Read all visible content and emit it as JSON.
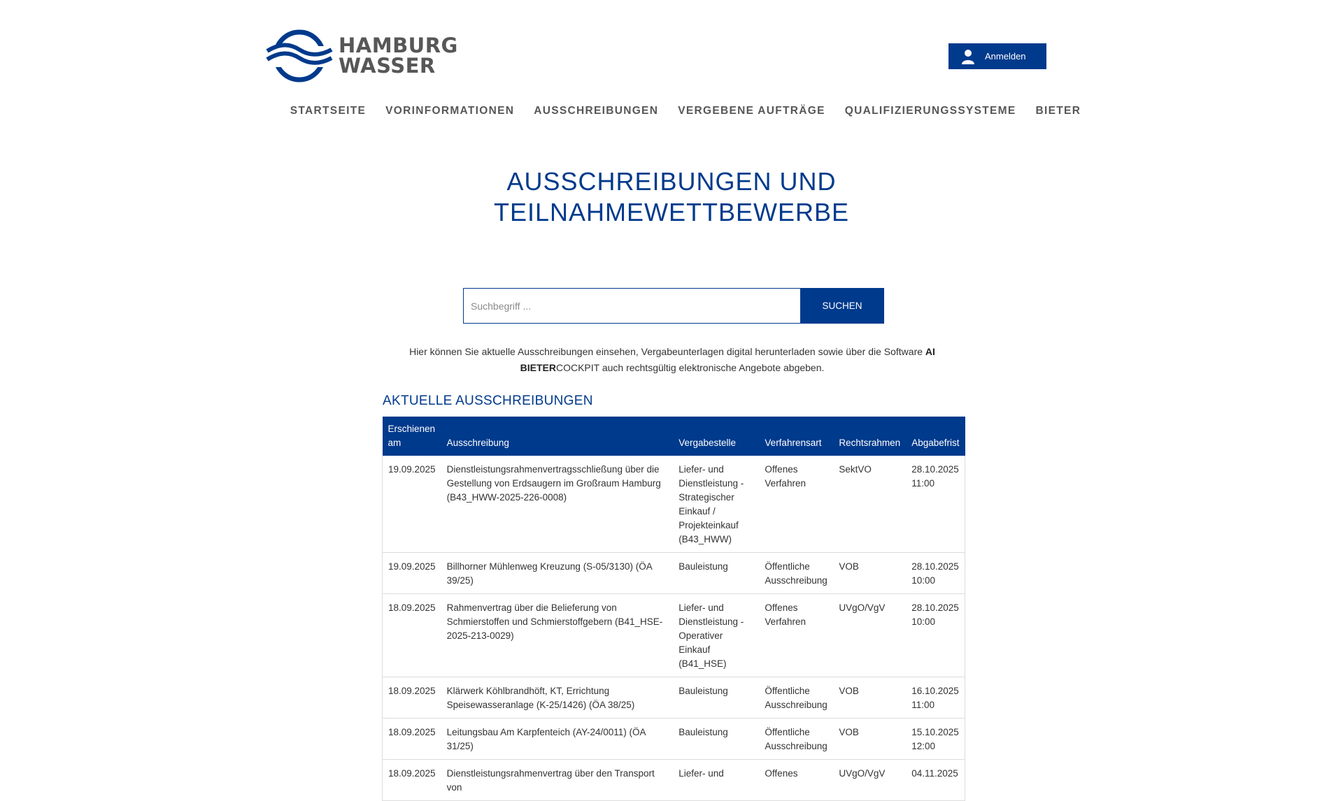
{
  "brand": {
    "line1": "HAMBURG",
    "line2": "WASSER",
    "color": "#003a8c"
  },
  "header": {
    "login_label": "Anmelden"
  },
  "nav": [
    {
      "label": "STARTSEITE"
    },
    {
      "label": "VORINFORMATIONEN"
    },
    {
      "label": "AUSSCHREIBUNGEN"
    },
    {
      "label": "VERGEBENE AUFTRÄGE"
    },
    {
      "label": "QUALIFIZIERUNGSSYSTEME"
    },
    {
      "label": "BIETER"
    }
  ],
  "page": {
    "title_line1": "AUSSCHREIBUNGEN UND",
    "title_line2": "TEILNAHMEWETTBEWERBE"
  },
  "search": {
    "placeholder": "Suchbegriff ...",
    "value": "",
    "button_label": "SUCHEN"
  },
  "intro": {
    "text_before": "Hier können Sie aktuelle Ausschreibungen einsehen, Vergabeunterlagen digital herunterladen sowie über die Software ",
    "brand_bold": "AI BIETER",
    "brand_rest": "COCKPIT",
    "text_after": " auch rechtsgültig elektronische Angebote abgeben."
  },
  "tenders": {
    "title": "AKTUELLE AUSSCHREIBUNGEN",
    "columns": {
      "published": "Erschienen am",
      "tender": "Ausschreibung",
      "authority": "Vergabestelle",
      "procedure": "Verfahrensart",
      "legal": "Rechtsrahmen",
      "deadline": "Abgabefrist"
    },
    "rows": [
      {
        "published": "19.09.2025",
        "tender": "Dienstleistungsrahmenvertragsschließung über die Gestellung von Erdsaugern im Großraum Hamburg (B43_HWW-2025-226-0008)",
        "authority": "Liefer- und Dienstleistung - Strategischer Einkauf / Projekteinkauf (B43_HWW)",
        "procedure": "Offenes Verfahren",
        "legal": "SektVO",
        "deadline": "28.10.2025 11:00"
      },
      {
        "published": "19.09.2025",
        "tender": "Billhorner Mühlenweg Kreuzung (S-05/3130) (ÖA 39/25)",
        "authority": "Bauleistung",
        "procedure": "Öffentliche Ausschreibung",
        "legal": "VOB",
        "deadline": "28.10.2025 10:00"
      },
      {
        "published": "18.09.2025",
        "tender": "Rahmenvertrag über die Belieferung von Schmierstoffen und Schmierstoffgebern (B41_HSE-2025-213-0029)",
        "authority": "Liefer- und Dienstleistung - Operativer Einkauf (B41_HSE)",
        "procedure": "Offenes Verfahren",
        "legal": "UVgO/VgV",
        "deadline": "28.10.2025 10:00"
      },
      {
        "published": "18.09.2025",
        "tender": "Klärwerk Köhlbrandhöft, KT, Errichtung Speisewasseranlage (K-25/1426) (ÖA 38/25)",
        "authority": "Bauleistung",
        "procedure": "Öffentliche Ausschreibung",
        "legal": "VOB",
        "deadline": "16.10.2025 11:00"
      },
      {
        "published": "18.09.2025",
        "tender": "Leitungsbau Am Karpfenteich (AY-24/0011) (ÖA 31/25)",
        "authority": "Bauleistung",
        "procedure": "Öffentliche Ausschreibung",
        "legal": "VOB",
        "deadline": "15.10.2025 12:00"
      },
      {
        "published": "18.09.2025",
        "tender": "Dienstleistungsrahmenvertrag über den Transport von",
        "authority": "Liefer- und",
        "procedure": "Offenes",
        "legal": "UVgO/VgV",
        "deadline": "04.11.2025"
      }
    ]
  }
}
